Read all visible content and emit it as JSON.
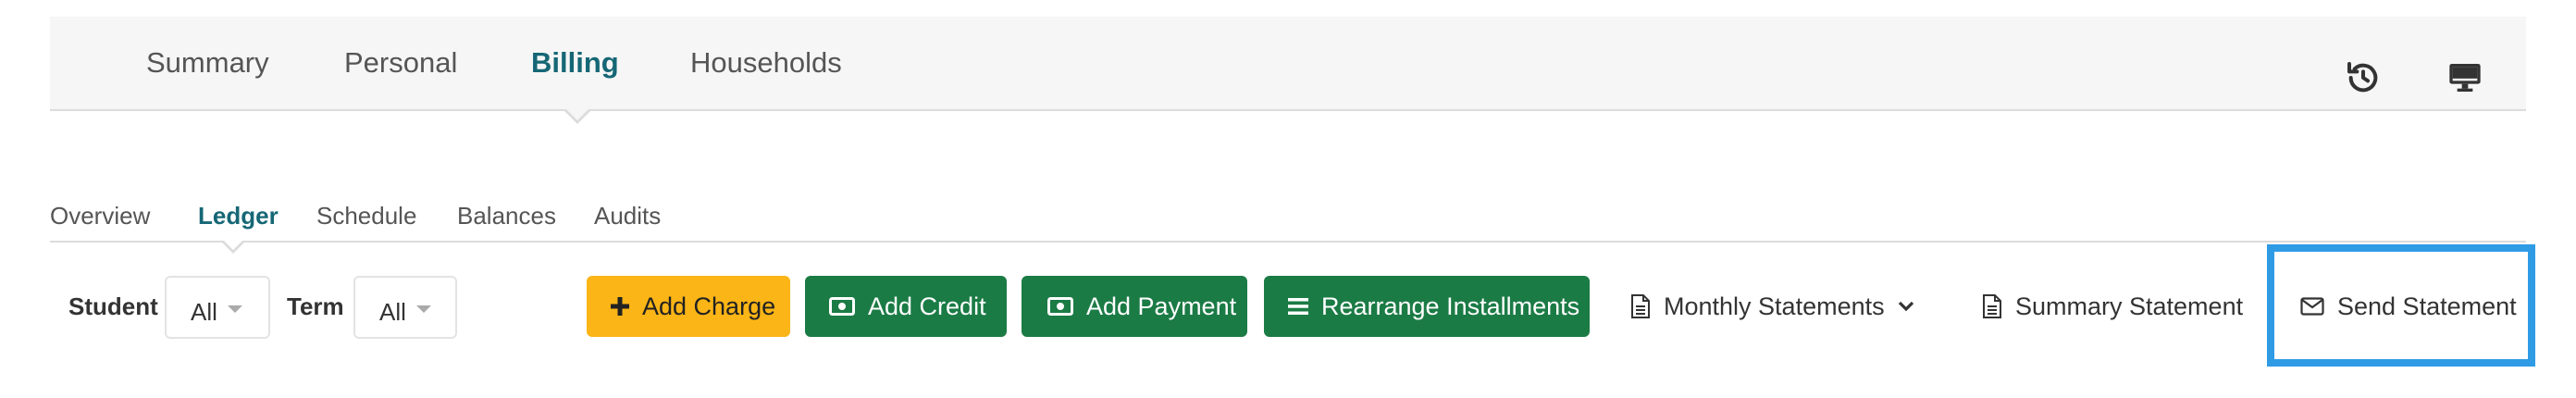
{
  "top_tabs": [
    {
      "label": "Summary"
    },
    {
      "label": "Personal"
    },
    {
      "label": "Billing",
      "active": true
    },
    {
      "label": "Households"
    }
  ],
  "top_icons": {
    "history": "history-icon",
    "display": "monitor-icon"
  },
  "sub_tabs": [
    {
      "label": "Overview"
    },
    {
      "label": "Ledger",
      "active": true
    },
    {
      "label": "Schedule"
    },
    {
      "label": "Balances"
    },
    {
      "label": "Audits"
    }
  ],
  "filters": {
    "student_label": "Student",
    "student_value": "All",
    "term_label": "Term",
    "term_value": "All"
  },
  "actions": {
    "add_charge": "Add Charge",
    "add_credit": "Add Credit",
    "add_payment": "Add Payment",
    "rearrange": "Rearrange Installments",
    "monthly_statements": "Monthly Statements",
    "summary_statement": "Summary Statement",
    "send_statement": "Send Statement"
  },
  "colors": {
    "accent": "#166775",
    "yellow": "#fbb516",
    "green": "#1b7b45",
    "highlight": "#2f9be5"
  }
}
